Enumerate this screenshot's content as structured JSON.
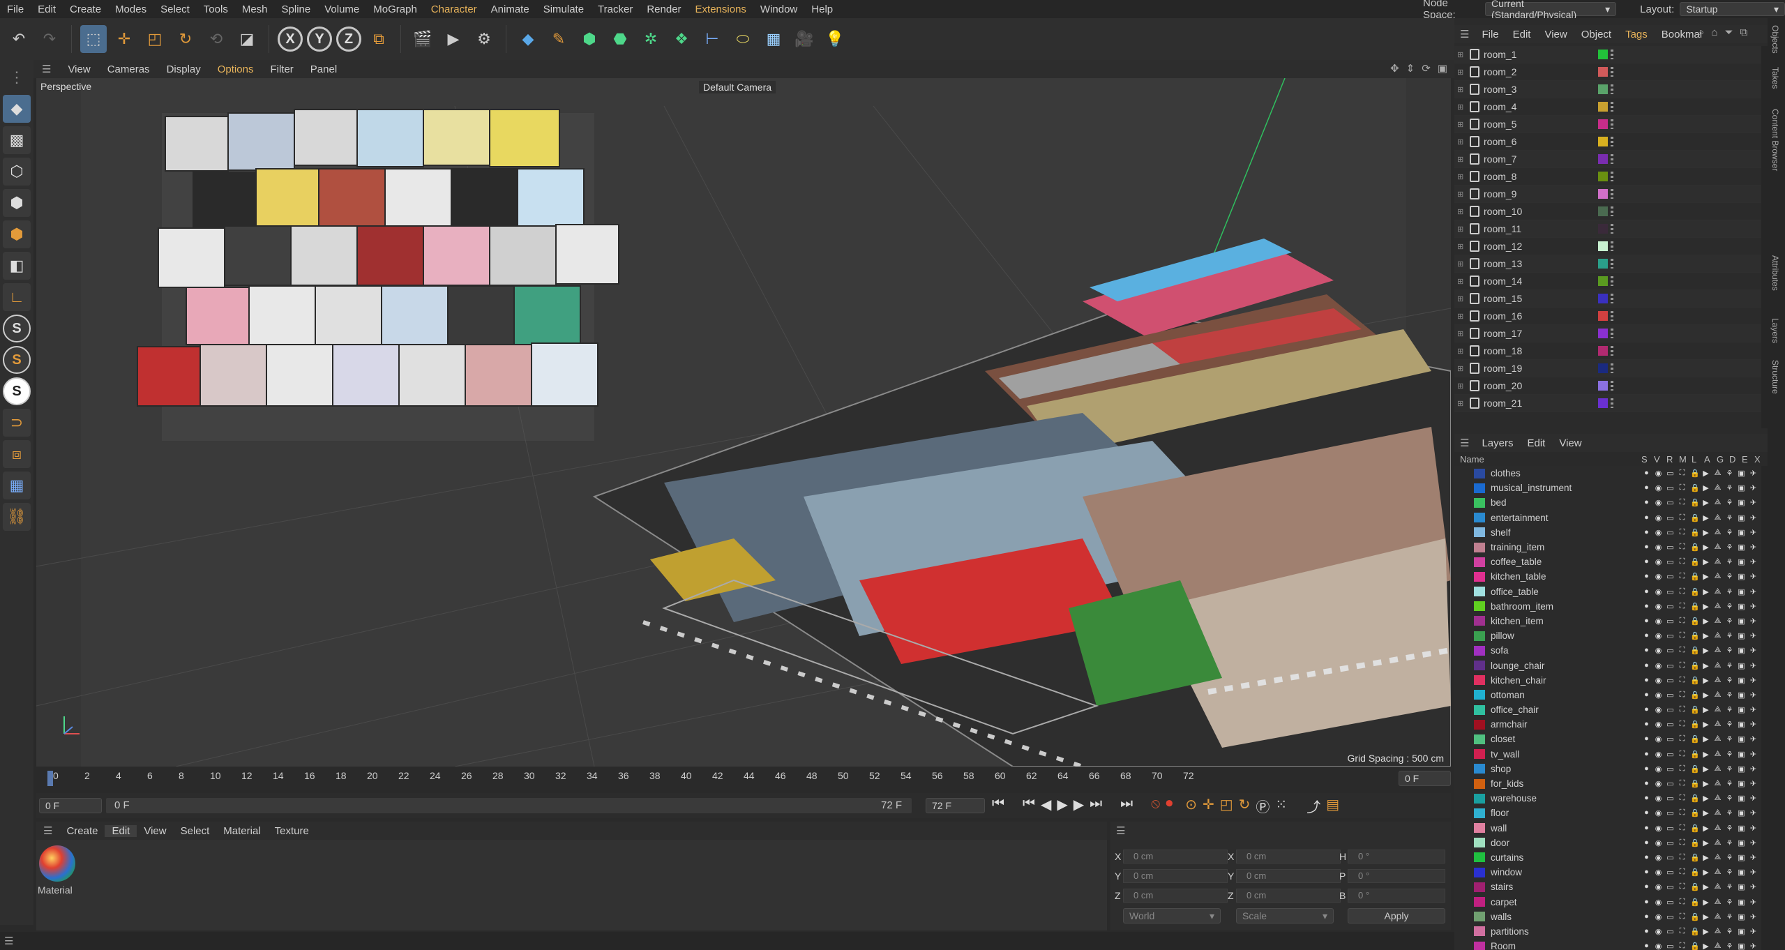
{
  "menubar": {
    "items": [
      "File",
      "Edit",
      "Create",
      "Modes",
      "Select",
      "Tools",
      "Mesh",
      "Spline",
      "Volume",
      "MoGraph",
      "Character",
      "Animate",
      "Simulate",
      "Tracker",
      "Render",
      "Extensions",
      "Window",
      "Help"
    ],
    "node_space_label": "Node Space:",
    "node_space_value": "Current (Standard/Physical)",
    "layout_label": "Layout:",
    "layout_value": "Startup"
  },
  "toolbar": {
    "axis_x": "X",
    "axis_y": "Y",
    "axis_z": "Z"
  },
  "viewport": {
    "menu": [
      "View",
      "Cameras",
      "Display",
      "Options",
      "Filter",
      "Panel"
    ],
    "view_name": "Perspective",
    "camera": "Default Camera",
    "grid_spacing": "Grid Spacing : 500 cm",
    "accent": "#e7b35a"
  },
  "timeline": {
    "ticks": [
      "0",
      "2",
      "4",
      "6",
      "8",
      "10",
      "12",
      "14",
      "16",
      "18",
      "20",
      "22",
      "24",
      "26",
      "28",
      "30",
      "32",
      "34",
      "36",
      "38",
      "40",
      "42",
      "44",
      "46",
      "48",
      "50",
      "52",
      "54",
      "56",
      "58",
      "60",
      "62",
      "64",
      "66",
      "68",
      "70",
      "72"
    ],
    "current_frame": "0 F",
    "start_field": "0 F",
    "range_start": "0 F",
    "range_end": "72 F",
    "end_field": "72 F"
  },
  "material": {
    "menu": [
      "Create",
      "Edit",
      "View",
      "Select",
      "Material",
      "Texture"
    ],
    "active": "Edit",
    "item_label": "Material"
  },
  "coords": {
    "x1": "0 cm",
    "y1": "0 cm",
    "z1": "0 cm",
    "x2": "0 cm",
    "y2": "0 cm",
    "z2": "0 cm",
    "h": "0 °",
    "p": "0 °",
    "b": "0 °",
    "lx": "X",
    "ly": "Y",
    "lz": "Z",
    "lx2": "X",
    "ly2": "Y",
    "lz2": "Z",
    "lh": "H",
    "lp": "P",
    "lb": "B",
    "mode1": "World",
    "mode2": "Scale",
    "apply": "Apply"
  },
  "objects": {
    "menu": [
      "File",
      "Edit",
      "View",
      "Object",
      "Tags",
      "Bookmai"
    ],
    "rows": [
      {
        "name": "room_1",
        "color": "#22c23a"
      },
      {
        "name": "room_2",
        "color": "#d05a5a"
      },
      {
        "name": "room_3",
        "color": "#5aa36a"
      },
      {
        "name": "room_4",
        "color": "#c8a030"
      },
      {
        "name": "room_5",
        "color": "#c82d8a"
      },
      {
        "name": "room_6",
        "color": "#d8b020"
      },
      {
        "name": "room_7",
        "color": "#7a2db0"
      },
      {
        "name": "room_8",
        "color": "#6a8f10"
      },
      {
        "name": "room_9",
        "color": "#d070c8"
      },
      {
        "name": "room_10",
        "color": "#4a6a50"
      },
      {
        "name": "room_11",
        "color": "#3a2a3a"
      },
      {
        "name": "room_12",
        "color": "#c8f0d0"
      },
      {
        "name": "room_13",
        "color": "#2aa08a"
      },
      {
        "name": "room_14",
        "color": "#5a9a20"
      },
      {
        "name": "room_15",
        "color": "#3a30c0"
      },
      {
        "name": "room_16",
        "color": "#d04040"
      },
      {
        "name": "room_17",
        "color": "#8a30d0"
      },
      {
        "name": "room_18",
        "color": "#b02a70"
      },
      {
        "name": "room_19",
        "color": "#1a2a80"
      },
      {
        "name": "room_20",
        "color": "#8a70e0"
      },
      {
        "name": "room_21",
        "color": "#6a30d0"
      }
    ]
  },
  "layers": {
    "menu": [
      "Layers",
      "Edit",
      "View"
    ],
    "header": {
      "name": "Name",
      "cols": [
        "S",
        "V",
        "R",
        "M",
        "L",
        "A",
        "G",
        "D",
        "E",
        "X"
      ]
    },
    "rows": [
      {
        "name": "clothes",
        "color": "#2a4aa0"
      },
      {
        "name": "musical_instrument",
        "color": "#1a6ad0"
      },
      {
        "name": "bed",
        "color": "#3ac060"
      },
      {
        "name": "entertainment",
        "color": "#2a8ad0"
      },
      {
        "name": "shelf",
        "color": "#80b8e0"
      },
      {
        "name": "training_item",
        "color": "#c08090"
      },
      {
        "name": "coffee_table",
        "color": "#d040a0"
      },
      {
        "name": "kitchen_table",
        "color": "#e03090"
      },
      {
        "name": "office_table",
        "color": "#a0e0e0"
      },
      {
        "name": "bathroom_item",
        "color": "#60d020"
      },
      {
        "name": "kitchen_item",
        "color": "#a03090"
      },
      {
        "name": "pillow",
        "color": "#3aa050"
      },
      {
        "name": "sofa",
        "color": "#a030c0"
      },
      {
        "name": "lounge_chair",
        "color": "#60308a"
      },
      {
        "name": "kitchen_chair",
        "color": "#e03060"
      },
      {
        "name": "ottoman",
        "color": "#20b0d0"
      },
      {
        "name": "office_chair",
        "color": "#30c0a0"
      },
      {
        "name": "armchair",
        "color": "#a01020"
      },
      {
        "name": "closet",
        "color": "#50c080"
      },
      {
        "name": "tv_wall",
        "color": "#d02050"
      },
      {
        "name": "shop",
        "color": "#2a8ad0"
      },
      {
        "name": "for_kids",
        "color": "#d06010"
      },
      {
        "name": "warehouse",
        "color": "#1aa0a0"
      },
      {
        "name": "floor",
        "color": "#30b0d0"
      },
      {
        "name": "wall",
        "color": "#e080a0"
      },
      {
        "name": "door",
        "color": "#a0e0c0"
      },
      {
        "name": "curtains",
        "color": "#20c040"
      },
      {
        "name": "window",
        "color": "#2a30d0"
      },
      {
        "name": "stairs",
        "color": "#a02070"
      },
      {
        "name": "carpet",
        "color": "#c02080"
      },
      {
        "name": "walls",
        "color": "#70a070"
      },
      {
        "name": "partitions",
        "color": "#d070a0"
      },
      {
        "name": "Room",
        "color": "#c030a0"
      }
    ]
  },
  "sidetabs": [
    "Objects",
    "Takes",
    "Content Browser",
    "Attributes",
    "Layers",
    "Structure"
  ]
}
